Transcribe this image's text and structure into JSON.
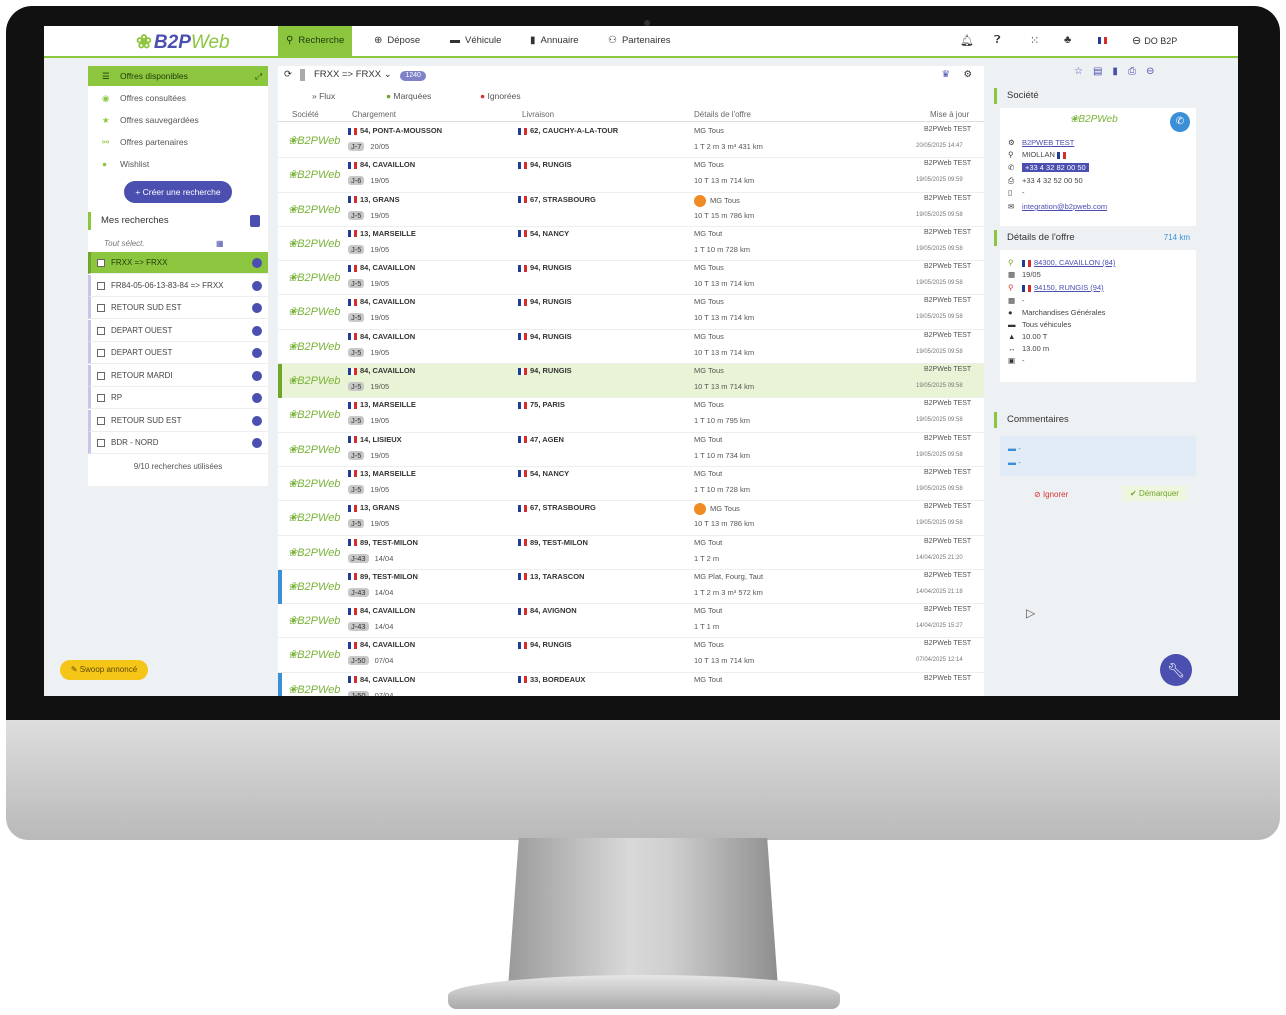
{
  "brand": {
    "logo_text": "B2P",
    "logo_web": "Web"
  },
  "nav": {
    "items": [
      {
        "label": "Recherche",
        "icon": "search-icon"
      },
      {
        "label": "Dépose",
        "icon": "plus-circle-icon"
      },
      {
        "label": "Véhicule",
        "icon": "truck-icon"
      },
      {
        "label": "Annuaire",
        "icon": "book-icon"
      },
      {
        "label": "Partenaires",
        "icon": "people-icon"
      }
    ],
    "user": "DO B2P"
  },
  "sidebar": {
    "offers": [
      {
        "label": "Offres disponibles"
      },
      {
        "label": "Offres consultées"
      },
      {
        "label": "Offres sauvegardées"
      },
      {
        "label": "Offres partenaires"
      },
      {
        "label": "Wishlist"
      }
    ],
    "create_label": "+ Créer une recherche",
    "searches_title": "Mes recherches",
    "tout_label": "Tout sélect.",
    "searches": [
      "FRXX => FRXX",
      "FR84-05-06-13-83-84 => FRXX",
      "RETOUR SUD EST",
      "DEPART OUEST",
      "DEPART OUEST",
      "RETOUR MARDI",
      "RP",
      "RETOUR SUD EST",
      "BDR - NORD"
    ],
    "used_label": "9/10 recherches utilisées",
    "new_offers_label": "Swoop annoncé"
  },
  "center": {
    "title": "FRXX => FRXX",
    "badge": "1240",
    "tabs": {
      "flux": "» Flux",
      "marked": "Marquées",
      "ignored": "Ignorées"
    },
    "columns": {
      "company": "Société",
      "loading": "Chargement",
      "delivery": "Livraison",
      "details": "Détails de l'offre",
      "updated": "Mise à jour"
    },
    "rows": [
      {
        "from": "54, PONT-A-MOUSSON",
        "j": "J-7",
        "date": "20/05",
        "to": "62, CAUCHY-A-LA-TOUR",
        "d1": "MG    Tous",
        "d2": "1 T    2 m    3 m³    431 km",
        "comp": "B2PWeb TEST",
        "upd": "20/05/2025 14:47",
        "hot": false,
        "hl": false,
        "bar": ""
      },
      {
        "from": "84, CAVAILLON",
        "j": "J-6",
        "date": "19/05",
        "to": "94, RUNGIS",
        "d1": "MG    Tous",
        "d2": "10 T    13 m    714 km",
        "comp": "B2PWeb TEST",
        "upd": "19/05/2025 09:59",
        "hot": false,
        "hl": false,
        "bar": ""
      },
      {
        "from": "13, GRANS",
        "j": "J-5",
        "date": "19/05",
        "to": "67, STRASBOURG",
        "d1": "MG    Tous",
        "d2": "10 T    15 m    786 km",
        "comp": "B2PWeb TEST",
        "upd": "19/05/2025 09:58",
        "hot": true,
        "hl": false,
        "bar": ""
      },
      {
        "from": "13, MARSEILLE",
        "j": "J-5",
        "date": "19/05",
        "to": "54, NANCY",
        "d1": "MG    Tout",
        "d2": "1 T    10 m    728 km",
        "comp": "B2PWeb TEST",
        "upd": "19/05/2025 09:58",
        "hot": false,
        "hl": false,
        "bar": ""
      },
      {
        "from": "84, CAVAILLON",
        "j": "J-5",
        "date": "19/05",
        "to": "94, RUNGIS",
        "d1": "MG    Tous",
        "d2": "10 T    13 m    714 km",
        "comp": "B2PWeb TEST",
        "upd": "19/05/2025 09:58",
        "hot": false,
        "hl": false,
        "bar": ""
      },
      {
        "from": "84, CAVAILLON",
        "j": "J-5",
        "date": "19/05",
        "to": "94, RUNGIS",
        "d1": "MG    Tous",
        "d2": "10 T    13 m    714 km",
        "comp": "B2PWeb TEST",
        "upd": "19/05/2025 09:58",
        "hot": false,
        "hl": false,
        "bar": ""
      },
      {
        "from": "84, CAVAILLON",
        "j": "J-5",
        "date": "19/05",
        "to": "94, RUNGIS",
        "d1": "MG    Tous",
        "d2": "10 T    13 m    714 km",
        "comp": "B2PWeb TEST",
        "upd": "19/05/2025 09:58",
        "hot": false,
        "hl": false,
        "bar": ""
      },
      {
        "from": "84, CAVAILLON",
        "j": "J-5",
        "date": "19/05",
        "to": "94, RUNGIS",
        "d1": "MG    Tous",
        "d2": "10 T    13 m    714 km",
        "comp": "B2PWeb TEST",
        "upd": "19/05/2025 09:58",
        "hot": false,
        "hl": true,
        "bar": "green"
      },
      {
        "from": "13, MARSEILLE",
        "j": "J-5",
        "date": "19/05",
        "to": "75, PARIS",
        "d1": "MG    Tous",
        "d2": "1 T    10 m    795 km",
        "comp": "B2PWeb TEST",
        "upd": "19/05/2025 09:58",
        "hot": false,
        "hl": false,
        "bar": ""
      },
      {
        "from": "14, LISIEUX",
        "j": "J-5",
        "date": "19/05",
        "to": "47, AGEN",
        "d1": "MG    Tout",
        "d2": "1 T    10 m    734 km",
        "comp": "B2PWeb TEST",
        "upd": "19/05/2025 09:58",
        "hot": false,
        "hl": false,
        "bar": ""
      },
      {
        "from": "13, MARSEILLE",
        "j": "J-5",
        "date": "19/05",
        "to": "54, NANCY",
        "d1": "MG    Tout",
        "d2": "1 T    10 m    728 km",
        "comp": "B2PWeb TEST",
        "upd": "19/05/2025 09:58",
        "hot": false,
        "hl": false,
        "bar": ""
      },
      {
        "from": "13, GRANS",
        "j": "J-5",
        "date": "19/05",
        "to": "67, STRASBOURG",
        "d1": "MG    Tous",
        "d2": "10 T    13 m    786 km",
        "comp": "B2PWeb TEST",
        "upd": "19/05/2025 09:58",
        "hot": true,
        "hl": false,
        "bar": ""
      },
      {
        "from": "89, TEST-MILON",
        "j": "J-43",
        "date": "14/04",
        "to": "89, TEST-MILON",
        "d1": "MG    Tout",
        "d2": "1 T    2 m",
        "comp": "B2PWeb TEST",
        "upd": "14/04/2025 21:20",
        "hot": false,
        "hl": false,
        "bar": ""
      },
      {
        "from": "89, TEST-MILON",
        "j": "J-43",
        "date": "14/04",
        "to": "13, TARASCON",
        "d1": "MG    Plat, Fourg, Taut",
        "d2": "1 T    2 m    3 m³    572 km",
        "comp": "B2PWeb TEST",
        "upd": "14/04/2025 21:18",
        "hot": false,
        "hl": false,
        "bar": "blue"
      },
      {
        "from": "84, CAVAILLON",
        "j": "J-43",
        "date": "14/04",
        "to": "84, AVIGNON",
        "d1": "MG    Tout",
        "d2": "1 T    1 m",
        "comp": "B2PWeb TEST",
        "upd": "14/04/2025 15:27",
        "hot": false,
        "hl": false,
        "bar": ""
      },
      {
        "from": "84, CAVAILLON",
        "j": "J-50",
        "date": "07/04",
        "to": "94, RUNGIS",
        "d1": "MG    Tous",
        "d2": "10 T    13 m    714 km",
        "comp": "B2PWeb TEST",
        "upd": "07/04/2025 12:14",
        "hot": false,
        "hl": false,
        "bar": ""
      },
      {
        "from": "84, CAVAILLON",
        "j": "J-50",
        "date": "07/04",
        "to": "33, BORDEAUX",
        "d1": "MG    Tout",
        "d2": "",
        "comp": "B2PWeb TEST",
        "upd": "",
        "hot": false,
        "hl": false,
        "bar": "blue"
      }
    ]
  },
  "right": {
    "company_title": "Société",
    "company_name": "B2PWEB TEST",
    "city": "MIOLLAN",
    "phone": "+33 4 32 82 00 50",
    "fax": "+33 4 32 52 00 50",
    "email": "integration@b2pweb.com",
    "details_title": "Détails de l'offre",
    "distance": "714 km",
    "loading_place": "84300, CAVAILLON (84)",
    "date": "19/05",
    "delivery_place": "94150, RUNGIS (94)",
    "goods": "Marchandises Générales",
    "vehicles": "Tous véhicules",
    "weight": "10.00 T",
    "length": "13.00 m",
    "comments_title": "Commentaires",
    "ignore_label": "Ignorer",
    "unmark_label": "Démarquer"
  }
}
